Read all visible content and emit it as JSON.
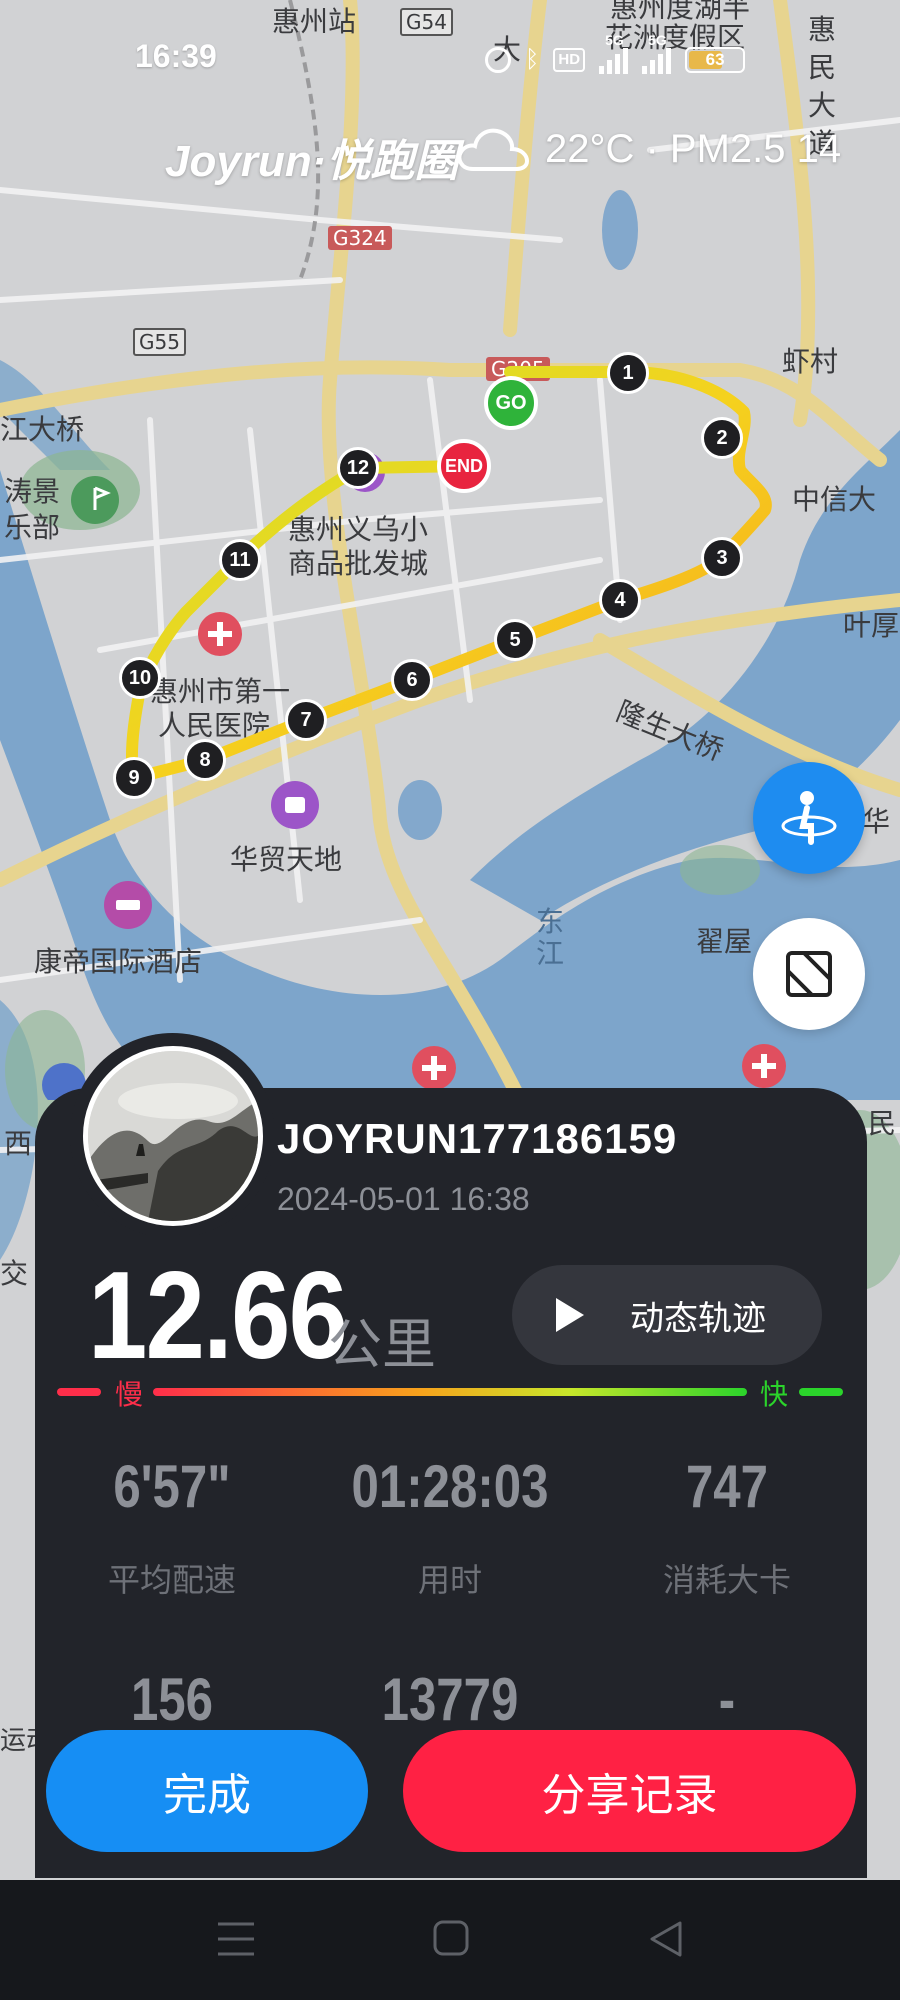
{
  "status_bar": {
    "time": "16:39",
    "network_1": "5G",
    "network_2": "5G",
    "hd_label": "HD",
    "battery": "63",
    "battery_fraction": 0.63
  },
  "header": {
    "brand": "Joyrun·悦跑圈",
    "weather": "22°C · PM2.5 14",
    "weather_icon": "cloud-icon"
  },
  "map": {
    "labels": [
      "惠州站",
      "G54",
      "大",
      "湖",
      "惠州度湖半",
      "花洲度假区",
      "惠",
      "民",
      "大",
      "道",
      "G324",
      "G55",
      "G205",
      "虾村",
      "江大桥",
      "涛景",
      "乐部",
      "惠州义乌小",
      "商品批发城",
      "中信大",
      "叶厚",
      "惠州市第一",
      "人民医院",
      "隆生大桥",
      "华贸天地",
      "华",
      "东",
      "江",
      "翟屋",
      "康帝国际酒店",
      "西",
      "交",
      "民",
      "运动"
    ],
    "start_marker": "GO",
    "end_marker": "END",
    "km_markers": [
      "1",
      "2",
      "3",
      "4",
      "5",
      "6",
      "7",
      "8",
      "9",
      "10",
      "11",
      "12"
    ],
    "locate_icon": "runner-location-icon",
    "layer_icon": "map-layer-icon"
  },
  "record": {
    "avatar_icon": "avatar-landscape-image",
    "username": "JOYRUN177186159",
    "datetime": "2024-05-01 16:38",
    "distance": "12.66",
    "distance_unit": "公里",
    "replay_label": "动态轨迹",
    "slow_label": "慢",
    "fast_label": "快",
    "stats": [
      {
        "value": "6'57\"",
        "label": "平均配速"
      },
      {
        "value": "01:28:03",
        "label": "用时"
      },
      {
        "value": "747",
        "label": "消耗大卡"
      },
      {
        "value": "156",
        "label": ""
      },
      {
        "value": "13779",
        "label": ""
      },
      {
        "value": "-",
        "label": ""
      }
    ]
  },
  "actions": {
    "done_label": "完成",
    "share_label": "分享记录"
  },
  "nav": {
    "icons": [
      "menu-icon",
      "home-square-icon",
      "back-triangle-icon"
    ]
  },
  "colors": {
    "card_bg": "#22242a",
    "done": "#168ef4",
    "share": "#ff2144",
    "slow": "#ff2e4a",
    "fast": "#2bd42b",
    "track_fast": "#c8e62a",
    "track_mid": "#f5d21e",
    "track_slow": "#f7a21c"
  }
}
